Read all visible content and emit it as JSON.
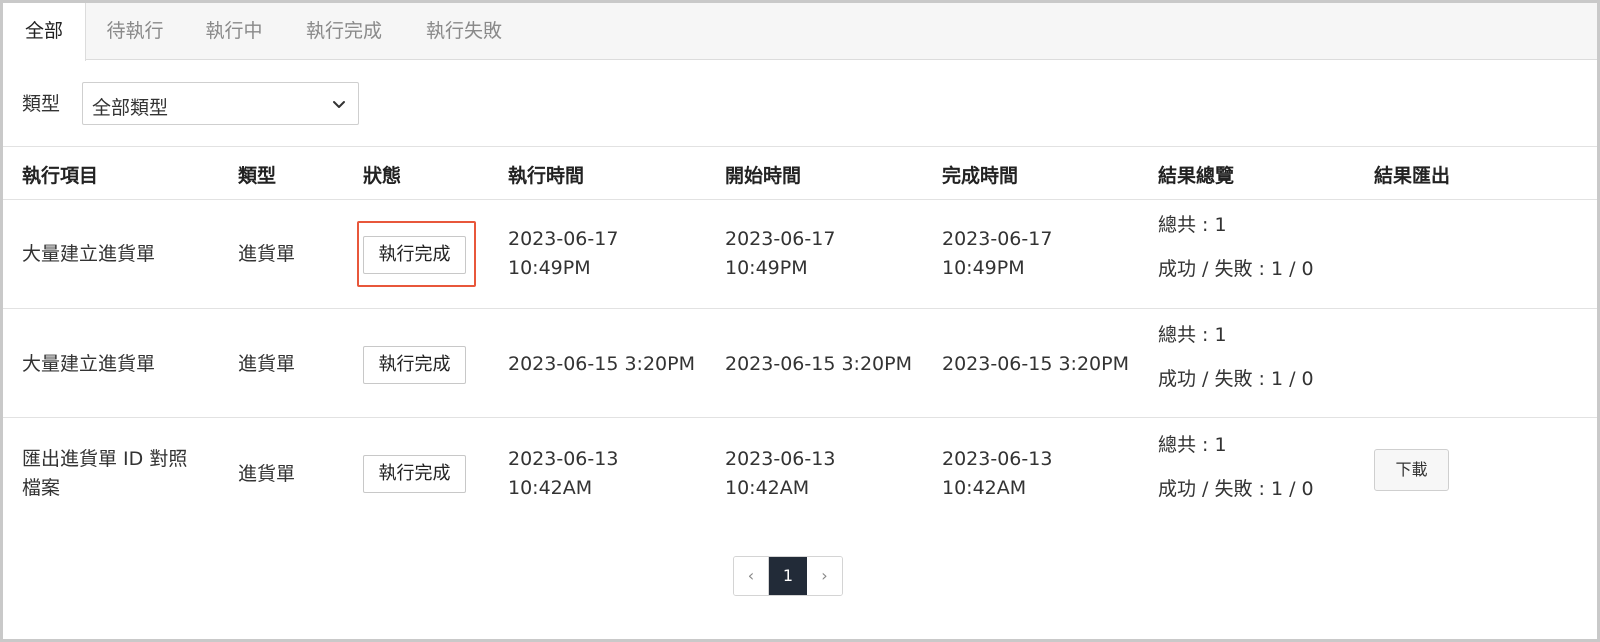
{
  "tabs": [
    {
      "label": "全部",
      "active": true
    },
    {
      "label": "待執行"
    },
    {
      "label": "執行中"
    },
    {
      "label": "執行完成"
    },
    {
      "label": "執行失敗"
    }
  ],
  "filter": {
    "label": "類型",
    "selected": "全部類型"
  },
  "table": {
    "headers": [
      "執行項目",
      "類型",
      "狀態",
      "執行時間",
      "開始時間",
      "完成時間",
      "結果總覽",
      "結果匯出"
    ],
    "rows": [
      {
        "item": [
          "大量建立進貨單"
        ],
        "type": "進貨單",
        "status": "執行完成",
        "exec_time": [
          "2023-06-17",
          "10:49PM"
        ],
        "start_time": [
          "2023-06-17",
          "10:49PM"
        ],
        "end_time": [
          "2023-06-17",
          "10:49PM"
        ],
        "summary_total": "總共 : 1",
        "summary_result": "成功 / 失敗 : 1 / 0",
        "export": ""
      },
      {
        "item": [
          "大量建立進貨單"
        ],
        "type": "進貨單",
        "status": "執行完成",
        "exec_time": [
          "2023-06-15 3:20PM"
        ],
        "start_time": [
          "2023-06-15 3:20PM"
        ],
        "end_time": [
          "2023-06-15 3:20PM"
        ],
        "summary_total": "總共 : 1",
        "summary_result": "成功 / 失敗 : 1 / 0",
        "export": ""
      },
      {
        "item": [
          "匯出進貨單 ID 對照",
          "檔案"
        ],
        "type": "進貨單",
        "status": "執行完成",
        "exec_time": [
          "2023-06-13",
          "10:42AM"
        ],
        "start_time": [
          "2023-06-13",
          "10:42AM"
        ],
        "end_time": [
          "2023-06-13",
          "10:42AM"
        ],
        "summary_total": "總共 : 1",
        "summary_result": "成功 / 失敗 : 1 / 0",
        "export": "下載"
      }
    ]
  },
  "pagination": {
    "prev": "‹",
    "current": "1",
    "next": "›"
  },
  "colors": {
    "highlight": "#e8573b",
    "active_page": "#222b38"
  }
}
